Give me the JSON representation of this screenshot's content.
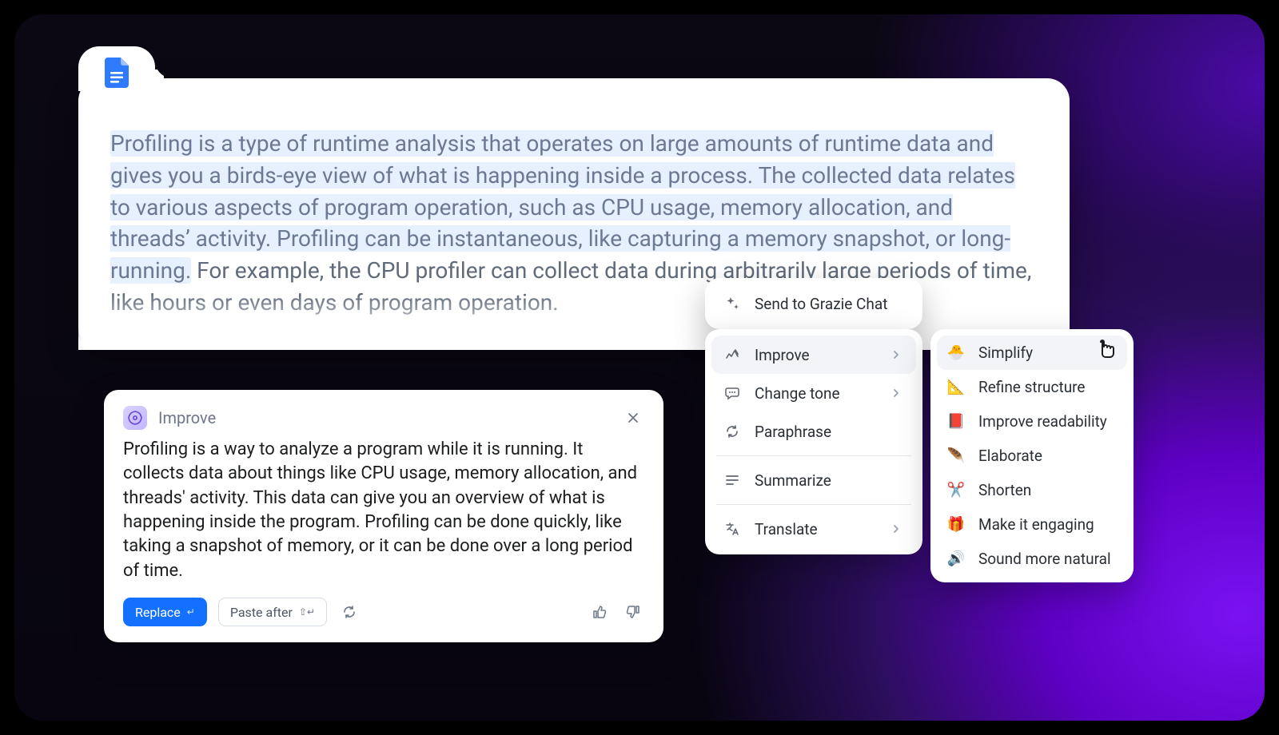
{
  "document": {
    "selected_text": "Profiling is a type of runtime analysis that operates on large amounts of runtime data and gives you a birds-eye view of what is happening inside a process. The collected data relates to various aspects of program operation, such as CPU usage, memory allocation, and threads’ activity. Profiling can be instantaneous, like capturing a memory snapshot, or long-running.",
    "trailing_text": " For example, the CPU profiler can collect data during arbitrarily large periods of time, like hours or even days of program operation."
  },
  "context_menu_top": {
    "send_to_chat": "Send to Grazie Chat"
  },
  "context_menu": {
    "improve": "Improve",
    "change_tone": "Change tone",
    "paraphrase": "Paraphrase",
    "summarize": "Summarize",
    "translate": "Translate"
  },
  "improve_submenu": {
    "simplify": "Simplify",
    "refine_structure": "Refine structure",
    "improve_readability": "Improve readability",
    "elaborate": "Elaborate",
    "shorten": "Shorten",
    "make_engaging": "Make it engaging",
    "sound_natural": "Sound more natural"
  },
  "result": {
    "title": "Improve",
    "body": "Profiling is a way to analyze a program while it is running. It collects data about things like CPU usage, memory allocation, and threads' activity. This data can give you an overview of what is happening inside the program. Profiling can be done quickly, like taking a snapshot of memory, or it can be done over a long period of time.",
    "replace_label": "Replace",
    "replace_kbd": "↵",
    "paste_after_label": "Paste after",
    "paste_after_kbd": "⇧↵"
  }
}
